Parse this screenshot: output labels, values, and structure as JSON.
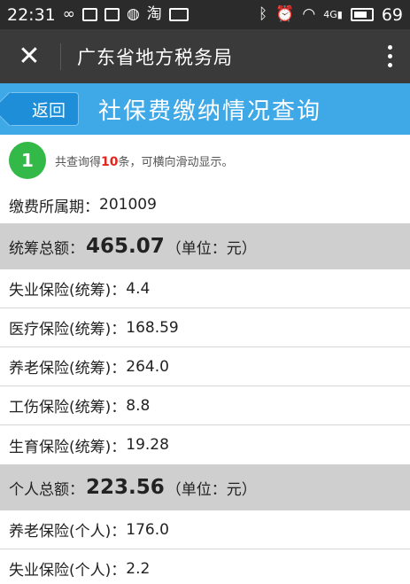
{
  "status_bar": {
    "time": "22:31",
    "battery": "69",
    "left_icons": [
      "infinity-icon",
      "image-icon",
      "square-icon",
      "chat-icon",
      "taobao-icon",
      "card-icon"
    ],
    "right_icons": [
      "bluetooth-icon",
      "alarm-icon",
      "wifi-icon",
      "signal-icon",
      "battery-icon"
    ],
    "signal_label": "4G"
  },
  "app_bar": {
    "title": "广东省地方税务局"
  },
  "page_header": {
    "back_label": "返回",
    "title": "社保费缴纳情况查询",
    "bg_color": "#3fa9e8"
  },
  "notice": {
    "step": "1",
    "prefix": "共查询得",
    "count": "10",
    "suffix": "条，可横向滑动显示。"
  },
  "period": {
    "label": "缴费所属期：",
    "value": "201009"
  },
  "pooled_total": {
    "label": "统筹总额：",
    "amount": "465.07",
    "unit": "（单位：元）"
  },
  "pooled_items": [
    {
      "label": "失业保险(统筹)：",
      "value": "4.4"
    },
    {
      "label": "医疗保险(统筹)：",
      "value": "168.59"
    },
    {
      "label": "养老保险(统筹)：",
      "value": "264.0"
    },
    {
      "label": "工伤保险(统筹)：",
      "value": "8.8"
    },
    {
      "label": "生育保险(统筹)：",
      "value": "19.28"
    }
  ],
  "personal_total": {
    "label": "个人总额：",
    "amount": "223.56",
    "unit": "（单位：元）"
  },
  "personal_items": [
    {
      "label": "养老保险(个人)：",
      "value": "176.0"
    },
    {
      "label": "失业保险(个人)：",
      "value": "2.2"
    }
  ]
}
